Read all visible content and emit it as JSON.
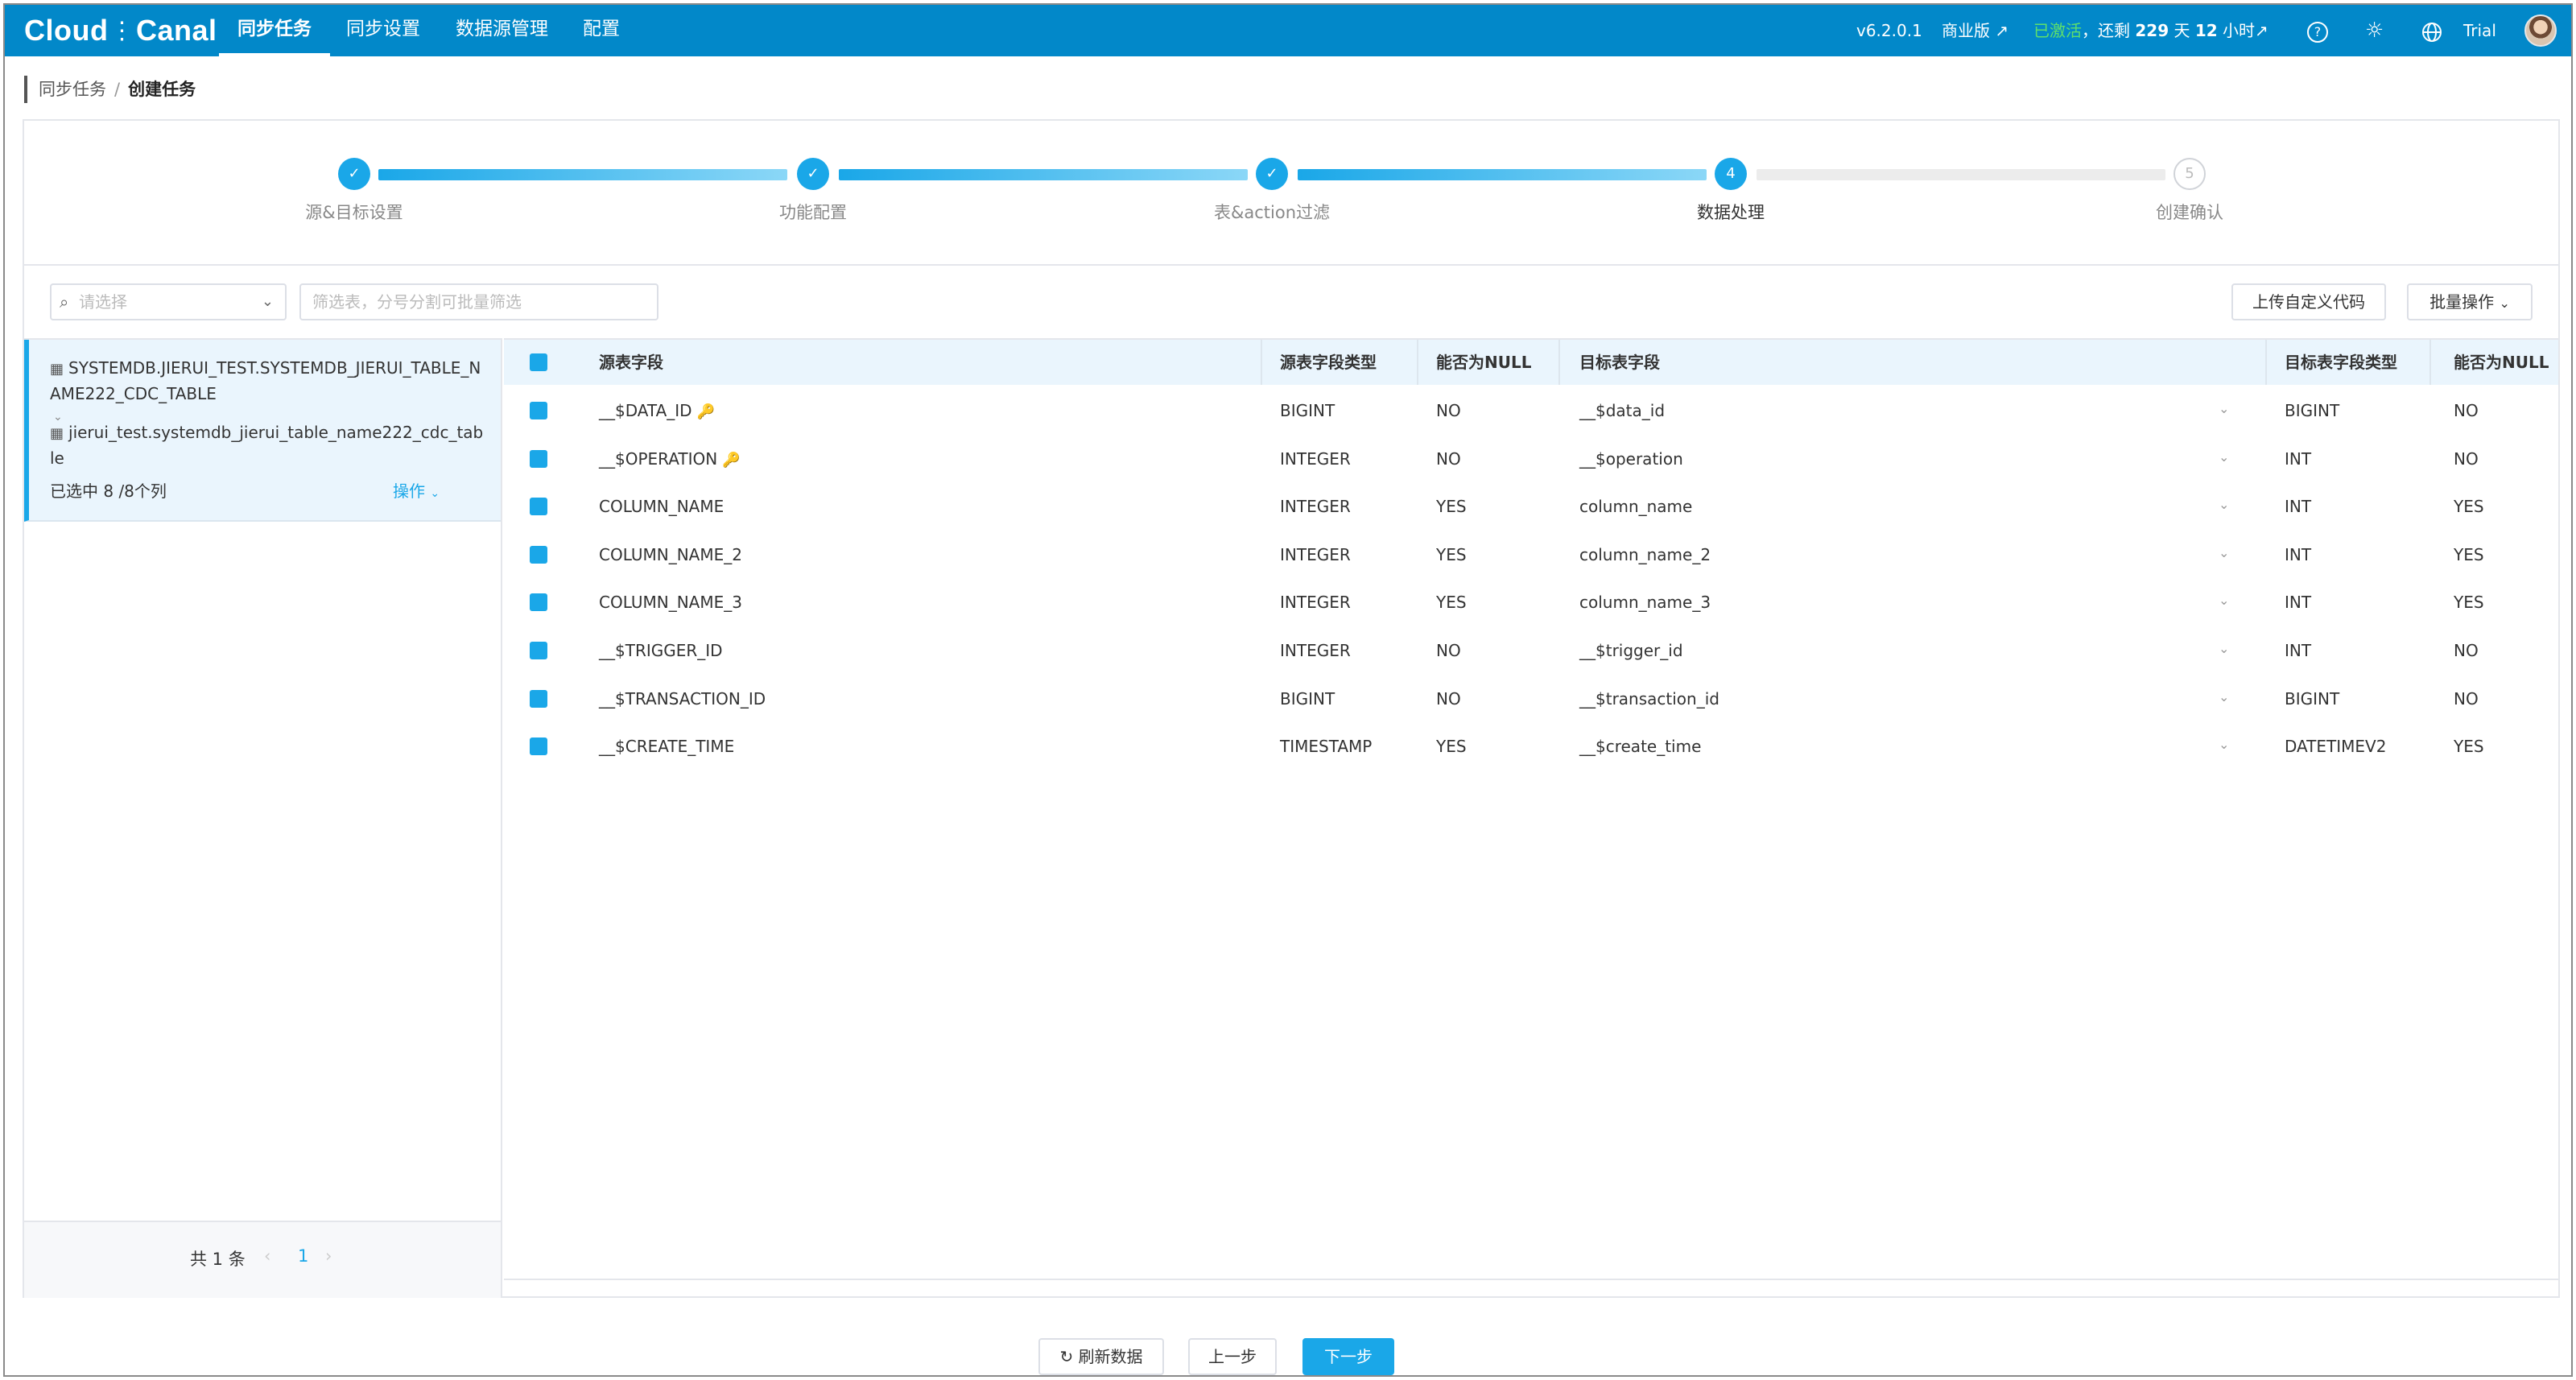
{
  "app": {
    "logo_text_a": "Cloud",
    "logo_text_b": "Canal",
    "nav": [
      "同步任务",
      "同步设置",
      "数据源管理",
      "配置"
    ],
    "version": "v6.2.0.1",
    "edition": "商业版 ↗",
    "activated": "已激活",
    "remaining_prefix": "，还剩",
    "remaining_days": "229",
    "days_unit": "天",
    "remaining_hours": "12",
    "hours_unit": "小时↗",
    "user": "Trial"
  },
  "breadcrumb": {
    "root": "同步任务",
    "sep": "/",
    "current": "创建任务"
  },
  "steps": [
    {
      "label": "源&目标设置",
      "status": "done",
      "mark": "✓"
    },
    {
      "label": "功能配置",
      "status": "done",
      "mark": "✓"
    },
    {
      "label": "表&action过滤",
      "status": "done",
      "mark": "✓"
    },
    {
      "label": "数据处理",
      "status": "current",
      "mark": "4"
    },
    {
      "label": "创建确认",
      "status": "pending",
      "mark": "5"
    }
  ],
  "filters": {
    "select_placeholder": "请选择",
    "table_filter_placeholder": "筛选表，分号分割可批量筛选",
    "upload_button": "上传自定义代码",
    "batch_button": "批量操作"
  },
  "left": {
    "source_table": "SYSTEMDB.JIERUI_TEST.SYSTEMDB_JIERUI_TABLE_NAME222_CDC_TABLE",
    "target_table": "jierui_test.systemdb_jierui_table_name222_cdc_table",
    "selected_label": "已选中 8 /8个列",
    "ops_label": "操作",
    "pager_total": "共 1 条",
    "pager_page": "1"
  },
  "grid": {
    "headers": [
      "源表字段",
      "源表字段类型",
      "能否为NULL",
      "目标表字段",
      "目标表字段类型",
      "能否为NULL"
    ],
    "rows": [
      {
        "src": "__$DATA_ID",
        "src_type": "BIGINT",
        "src_null": "NO",
        "dst": "__$data_id",
        "dst_type": "BIGINT",
        "dst_null": "NO",
        "key": true
      },
      {
        "src": "__$OPERATION",
        "src_type": "INTEGER",
        "src_null": "NO",
        "dst": "__$operation",
        "dst_type": "INT",
        "dst_null": "NO",
        "key": true
      },
      {
        "src": "COLUMN_NAME",
        "src_type": "INTEGER",
        "src_null": "YES",
        "dst": "column_name",
        "dst_type": "INT",
        "dst_null": "YES",
        "key": false
      },
      {
        "src": "COLUMN_NAME_2",
        "src_type": "INTEGER",
        "src_null": "YES",
        "dst": "column_name_2",
        "dst_type": "INT",
        "dst_null": "YES",
        "key": false
      },
      {
        "src": "COLUMN_NAME_3",
        "src_type": "INTEGER",
        "src_null": "YES",
        "dst": "column_name_3",
        "dst_type": "INT",
        "dst_null": "YES",
        "key": false
      },
      {
        "src": "__$TRIGGER_ID",
        "src_type": "INTEGER",
        "src_null": "NO",
        "dst": "__$trigger_id",
        "dst_type": "INT",
        "dst_null": "NO",
        "key": false
      },
      {
        "src": "__$TRANSACTION_ID",
        "src_type": "BIGINT",
        "src_null": "NO",
        "dst": "__$transaction_id",
        "dst_type": "BIGINT",
        "dst_null": "NO",
        "key": false
      },
      {
        "src": "__$CREATE_TIME",
        "src_type": "TIMESTAMP",
        "src_null": "YES",
        "dst": "__$create_time",
        "dst_type": "DATETIMEV2",
        "dst_null": "YES",
        "key": false
      }
    ]
  },
  "footer": {
    "refresh": "刷新数据",
    "prev": "上一步",
    "next": "下一步"
  },
  "colors": {
    "brand": "#0288c9",
    "accent": "#1aa7e8",
    "active_green": "#5fe06a",
    "key_icon": "#f5a623"
  },
  "icons": [
    "search-icon",
    "chevron-down-icon",
    "check-icon",
    "table-icon",
    "key-icon",
    "refresh-icon",
    "help-icon",
    "sun-icon",
    "globe-icon"
  ]
}
